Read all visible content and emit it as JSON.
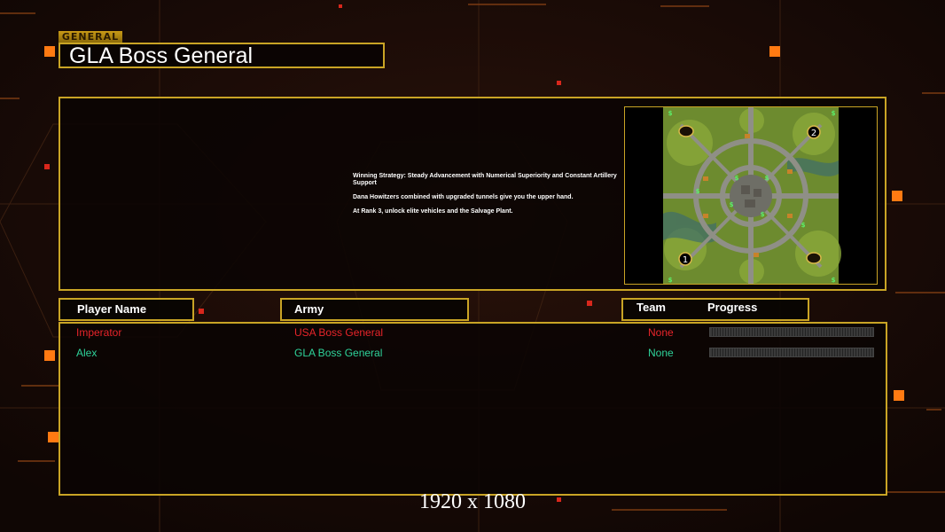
{
  "header": {
    "tag": "GENERAL",
    "title": "GLA Boss General"
  },
  "briefing": {
    "lines": [
      "Winning Strategy: Steady Advancement with Numerical Superiority and Constant Artillery Support",
      "Dana Howitzers combined with upgraded tunnels give you the upper hand.",
      "At Rank 3, unlock elite vehicles and the Salvage Plant."
    ]
  },
  "map": {
    "start_positions": [
      "1",
      "2"
    ],
    "money_marker": "$"
  },
  "columns": {
    "player": "Player Name",
    "army": "Army",
    "team": "Team",
    "progress": "Progress"
  },
  "players": [
    {
      "name": "Imperator",
      "army": "USA Boss General",
      "team": "None",
      "color": "#e8242a"
    },
    {
      "name": "Alex",
      "army": "GLA Boss General",
      "team": "None",
      "color": "#2ed39a"
    }
  ],
  "footer": {
    "resolution": "1920 x 1080"
  },
  "colors": {
    "frame": "#c9a425",
    "accent": "#ff7a12",
    "background": "#150906"
  }
}
